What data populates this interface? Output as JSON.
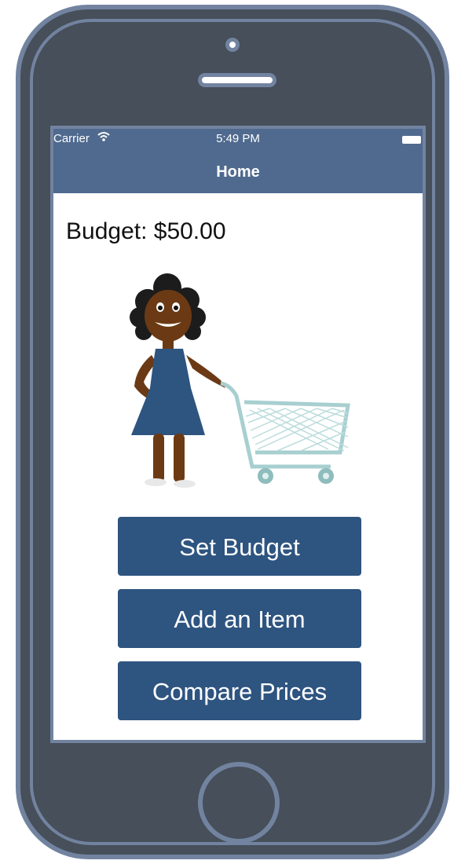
{
  "status_bar": {
    "carrier": "Carrier",
    "time": "5:49 PM"
  },
  "nav": {
    "title": "Home"
  },
  "budget": {
    "label": "Budget: $50.00"
  },
  "buttons": {
    "set_budget": "Set Budget",
    "add_item": "Add an Item",
    "compare_prices": "Compare Prices"
  },
  "colors": {
    "nav_bar": "#4f6a8e",
    "button": "#2e5480",
    "phone_body": "#464f5a",
    "phone_outline": "#7283a0"
  },
  "icons": [
    "wifi-icon",
    "battery-icon",
    "camera-icon",
    "speaker-icon",
    "home-button-icon"
  ]
}
